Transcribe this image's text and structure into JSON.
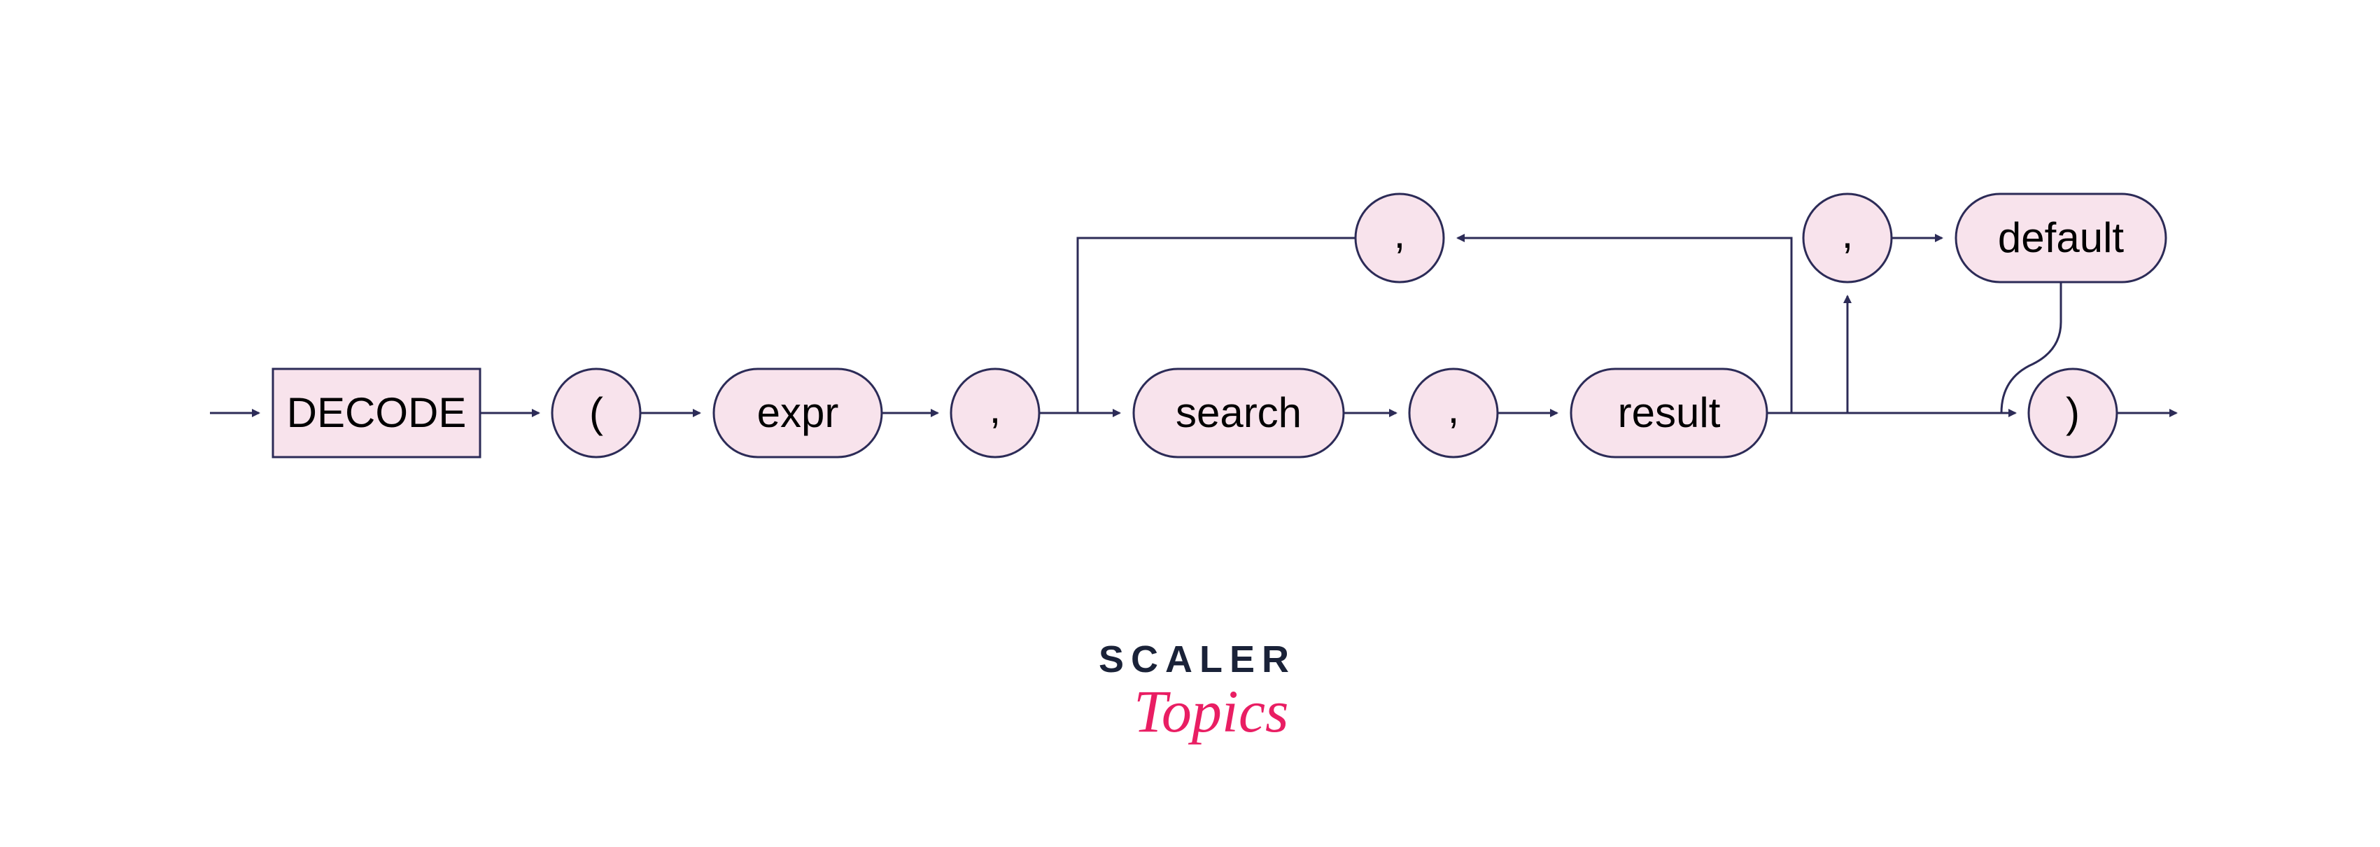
{
  "diagram": {
    "nodes": {
      "decode": "DECODE",
      "open_paren": "(",
      "expr": "expr",
      "comma1": ",",
      "search": "search",
      "comma2": ",",
      "result": "result",
      "comma_loop": ",",
      "comma_default": ",",
      "default": "default",
      "close_paren": ")"
    }
  },
  "branding": {
    "line1": "SCALER",
    "line2": "Topics"
  },
  "colors": {
    "node_fill": "#f8e3ec",
    "node_stroke": "#2c2b57",
    "line": "#2c2b57",
    "logo_dark": "#1a2238",
    "logo_pink": "#e91e63"
  }
}
